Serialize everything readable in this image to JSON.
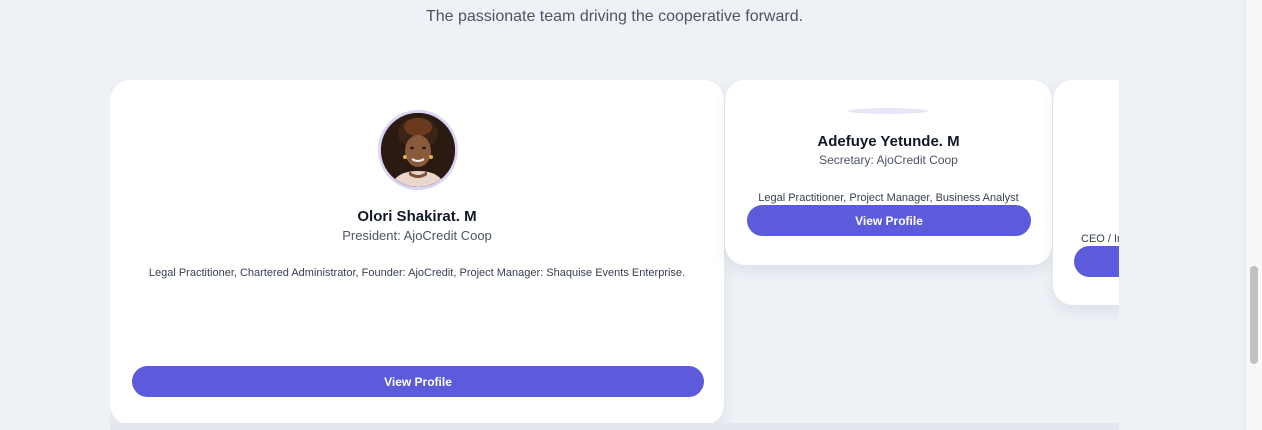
{
  "section": {
    "subtitle": "The passionate team driving the cooperative forward."
  },
  "team": [
    {
      "name": "Olori Shakirat. M",
      "role": "President: AjoCredit Coop",
      "bio": "Legal Practitioner, Chartered Administrator, Founder: AjoCredit, Project Manager: Shaquise Events Enterprise.",
      "button_label": "View Profile",
      "avatar_icon": "portrait-photo"
    },
    {
      "name": "Adefuye Yetunde. M",
      "role": "Secretary: AjoCredit Coop",
      "bio": "Legal Practitioner, Project Manager, Business Analyst",
      "button_label": "View Profile",
      "avatar_icon": "avatar-placeholder"
    },
    {
      "bio": "CEO / In",
      "button_label": ""
    }
  ],
  "colors": {
    "background": "#eef1f6",
    "card": "#ffffff",
    "accent": "#5b5bdc",
    "avatar_border": "#d9d6f5"
  }
}
